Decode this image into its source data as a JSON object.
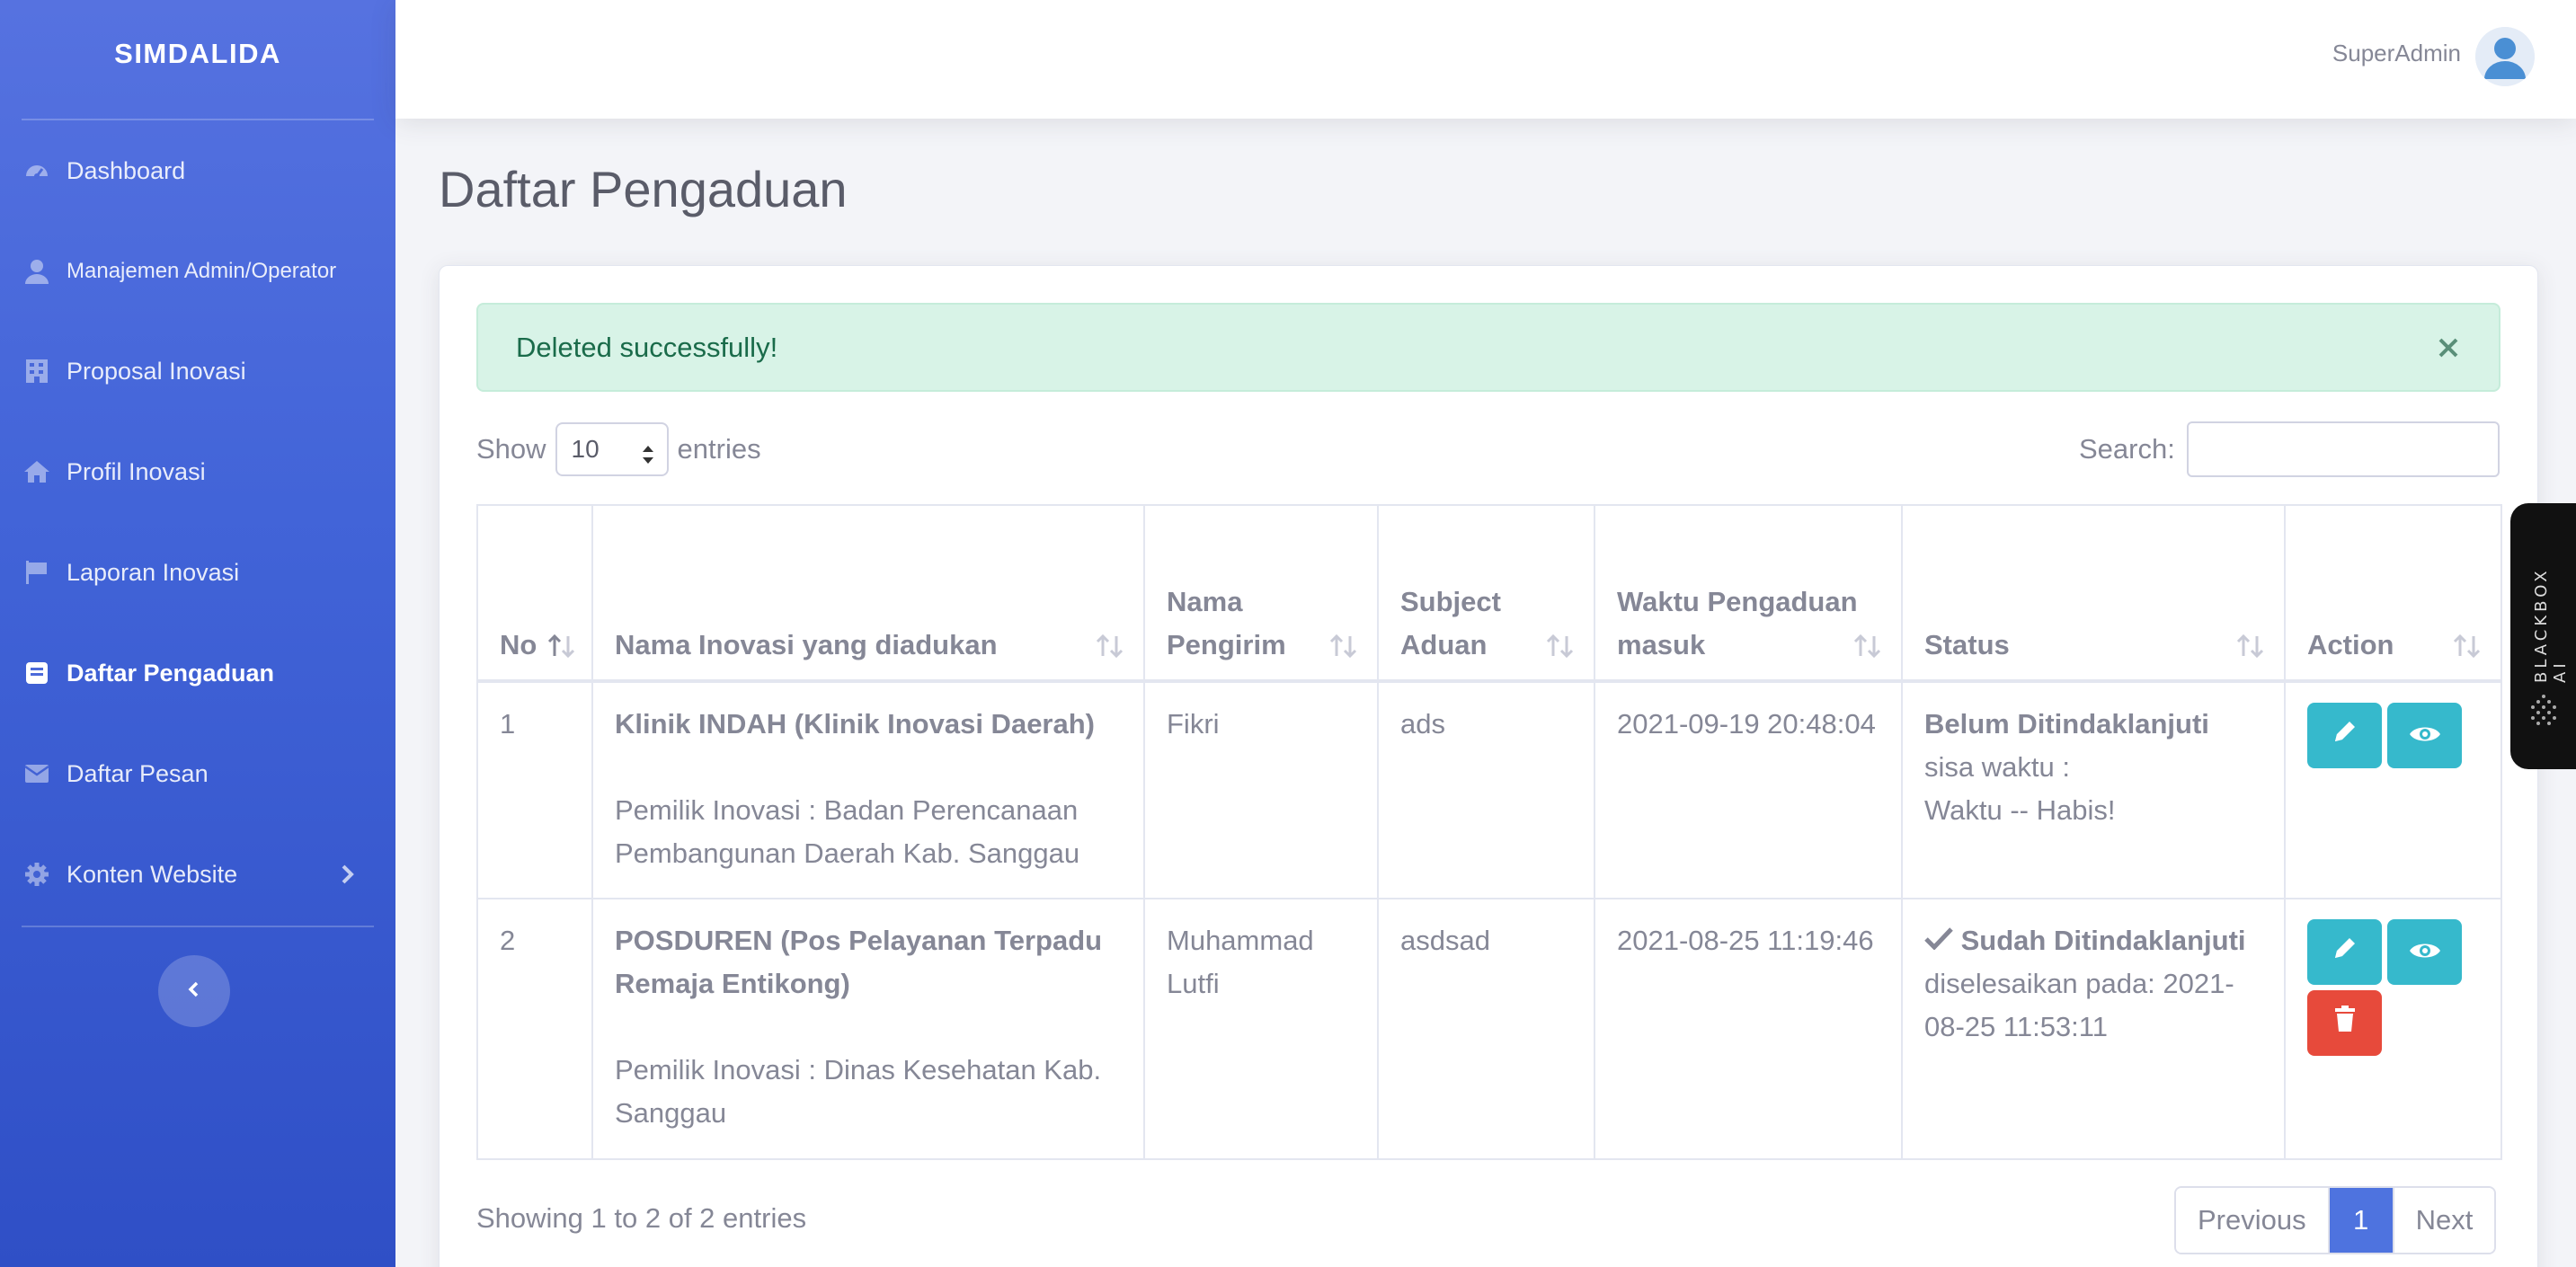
{
  "brand": "SIMDALIDA",
  "sidebar": {
    "items": [
      {
        "label": "Dashboard",
        "icon": "gauge-icon"
      },
      {
        "label": "Manajemen Admin/Operator",
        "icon": "user-icon"
      },
      {
        "label": "Proposal Inovasi",
        "icon": "building-icon"
      },
      {
        "label": "Profil Inovasi",
        "icon": "home-icon"
      },
      {
        "label": "Laporan Inovasi",
        "icon": "flag-icon"
      },
      {
        "label": "Daftar Pengaduan",
        "icon": "book-icon",
        "active": true
      },
      {
        "label": "Daftar Pesan",
        "icon": "envelope-icon"
      },
      {
        "label": "Konten Website",
        "icon": "gear-icon"
      }
    ]
  },
  "topbar": {
    "user": "SuperAdmin"
  },
  "page": {
    "title": "Daftar Pengaduan"
  },
  "alert": {
    "message": "Deleted successfully!"
  },
  "table_controls": {
    "show": "Show",
    "entries_value": "10",
    "entries": "entries",
    "search": "Search:"
  },
  "table": {
    "headers": [
      "No",
      "Nama Inovasi yang diadukan",
      "Nama Pengirim",
      "Subject Aduan",
      "Waktu Pengaduan masuk",
      "Status",
      "Action"
    ],
    "rows": [
      {
        "no": "1",
        "inovasi": "Klinik INDAH (Klinik Inovasi Daerah)",
        "pemilik": "Pemilik Inovasi : Badan Perencanaan Pembangunan Daerah Kab. Sanggau",
        "pengirim": "Fikri",
        "subject": "ads",
        "waktu": "2021-09-19 20:48:04",
        "status_title": "Belum Ditindaklanjuti",
        "status_line1": "sisa waktu :",
        "status_line2": "Waktu -- Habis!"
      },
      {
        "no": "2",
        "inovasi": "POSDUREN (Pos Pelayanan Terpadu Remaja Entikong)",
        "pemilik": "Pemilik Inovasi : Dinas Kesehatan Kab. Sanggau",
        "pengirim": "Muhammad Lutfi",
        "subject": "asdsad",
        "waktu": "2021-08-25 11:19:46",
        "status_title": "Sudah Ditindaklanjuti",
        "status_line1": "diselesaikan pada: 2021-08-25 11:53:11"
      }
    ]
  },
  "footer": {
    "info": "Showing 1 to 2 of 2 entries",
    "prev": "Previous",
    "page": "1",
    "next": "Next"
  },
  "blackbox": {
    "label": "BLACKBOX AI"
  },
  "colors": {
    "primary": "#4e73df",
    "info": "#36b9cc",
    "danger": "#e74a3b",
    "success_bg": "#d8f3e7"
  }
}
